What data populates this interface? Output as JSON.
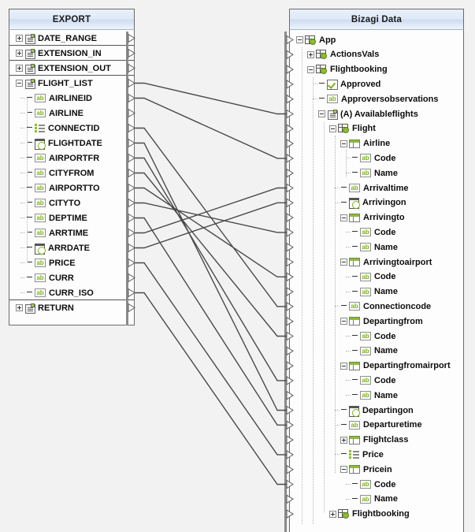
{
  "window": {
    "background": "#f2f2f2"
  },
  "left_panel": {
    "title": "EXPORT",
    "rows": [
      {
        "label": "DATE_RANGE",
        "indent": 0,
        "icon": "node-icon",
        "expander": "plus",
        "port": true,
        "separator_after": true
      },
      {
        "label": "EXTENSION_IN",
        "indent": 0,
        "icon": "node-icon",
        "expander": "plus",
        "port": true,
        "separator_after": true
      },
      {
        "label": "EXTENSION_OUT",
        "indent": 0,
        "icon": "node-icon",
        "expander": "plus",
        "port": true,
        "separator_after": true
      },
      {
        "label": "FLIGHT_LIST",
        "indent": 0,
        "icon": "node-icon",
        "expander": "minus",
        "port": true
      },
      {
        "label": "AIRLINEID",
        "indent": 1,
        "icon": "ab-icon",
        "expander": "none",
        "port": true
      },
      {
        "label": "AIRLINE",
        "indent": 1,
        "icon": "ab-icon",
        "expander": "none",
        "port": true
      },
      {
        "label": "CONNECTID",
        "indent": 1,
        "icon": "list-icon",
        "expander": "none",
        "port": true
      },
      {
        "label": "FLIGHTDATE",
        "indent": 1,
        "icon": "date-icon",
        "expander": "none",
        "port": true
      },
      {
        "label": "AIRPORTFR",
        "indent": 1,
        "icon": "ab-icon",
        "expander": "none",
        "port": true
      },
      {
        "label": "CITYFROM",
        "indent": 1,
        "icon": "ab-icon",
        "expander": "none",
        "port": true
      },
      {
        "label": "AIRPORTTO",
        "indent": 1,
        "icon": "ab-icon",
        "expander": "none",
        "port": true
      },
      {
        "label": "CITYTO",
        "indent": 1,
        "icon": "ab-icon",
        "expander": "none",
        "port": true
      },
      {
        "label": "DEPTIME",
        "indent": 1,
        "icon": "ab-icon",
        "expander": "none",
        "port": true
      },
      {
        "label": "ARRTIME",
        "indent": 1,
        "icon": "ab-icon",
        "expander": "none",
        "port": true
      },
      {
        "label": "ARRDATE",
        "indent": 1,
        "icon": "date-icon",
        "expander": "none",
        "port": true
      },
      {
        "label": "PRICE",
        "indent": 1,
        "icon": "ab-icon",
        "expander": "none",
        "port": true
      },
      {
        "label": "CURR",
        "indent": 1,
        "icon": "ab-icon",
        "expander": "none",
        "port": true
      },
      {
        "label": "CURR_ISO",
        "indent": 1,
        "icon": "ab-icon",
        "expander": "none",
        "port": true,
        "separator_after": true
      },
      {
        "label": "RETURN",
        "indent": 0,
        "icon": "node-icon",
        "expander": "plus",
        "port": true
      }
    ]
  },
  "right_panel": {
    "title": "Bizagi Data",
    "rows": [
      {
        "label": "App",
        "indent": 0,
        "icon": "entity-icon",
        "expander": "minus",
        "port": true
      },
      {
        "label": "ActionsVals",
        "indent": 1,
        "icon": "entity-icon",
        "expander": "plus",
        "port": true
      },
      {
        "label": "Flightbooking",
        "indent": 1,
        "icon": "entity-icon",
        "expander": "minus",
        "port": true
      },
      {
        "label": "Approved",
        "indent": 2,
        "icon": "bool-icon",
        "expander": "none",
        "port": true
      },
      {
        "label": "Approversobservations",
        "indent": 2,
        "icon": "ab-icon",
        "expander": "none",
        "port": true
      },
      {
        "label": "(A) Availableflights",
        "indent": 2,
        "icon": "node-icon",
        "expander": "minus",
        "port": true
      },
      {
        "label": "Flight",
        "indent": 3,
        "icon": "entity-icon",
        "expander": "minus",
        "port": true
      },
      {
        "label": "Airline",
        "indent": 4,
        "icon": "table-icon",
        "expander": "minus",
        "port": true
      },
      {
        "label": "Code",
        "indent": 5,
        "icon": "ab-icon",
        "expander": "none",
        "port": true
      },
      {
        "label": "Name",
        "indent": 5,
        "icon": "ab-icon",
        "expander": "none",
        "port": true
      },
      {
        "label": "Arrivaltime",
        "indent": 4,
        "icon": "ab-icon",
        "expander": "none",
        "port": true
      },
      {
        "label": "Arrivingon",
        "indent": 4,
        "icon": "date-icon",
        "expander": "none",
        "port": true
      },
      {
        "label": "Arrivingto",
        "indent": 4,
        "icon": "table-icon",
        "expander": "minus",
        "port": true
      },
      {
        "label": "Code",
        "indent": 5,
        "icon": "ab-icon",
        "expander": "none",
        "port": true
      },
      {
        "label": "Name",
        "indent": 5,
        "icon": "ab-icon",
        "expander": "none",
        "port": true
      },
      {
        "label": "Arrivingtoairport",
        "indent": 4,
        "icon": "table-icon",
        "expander": "minus",
        "port": true
      },
      {
        "label": "Code",
        "indent": 5,
        "icon": "ab-icon",
        "expander": "none",
        "port": true
      },
      {
        "label": "Name",
        "indent": 5,
        "icon": "ab-icon",
        "expander": "none",
        "port": true
      },
      {
        "label": "Connectioncode",
        "indent": 4,
        "icon": "ab-icon",
        "expander": "none",
        "port": true
      },
      {
        "label": "Departingfrom",
        "indent": 4,
        "icon": "table-icon",
        "expander": "minus",
        "port": true
      },
      {
        "label": "Code",
        "indent": 5,
        "icon": "ab-icon",
        "expander": "none",
        "port": true
      },
      {
        "label": "Name",
        "indent": 5,
        "icon": "ab-icon",
        "expander": "none",
        "port": true
      },
      {
        "label": "Departingfromairport",
        "indent": 4,
        "icon": "table-icon",
        "expander": "minus",
        "port": true
      },
      {
        "label": "Code",
        "indent": 5,
        "icon": "ab-icon",
        "expander": "none",
        "port": true
      },
      {
        "label": "Name",
        "indent": 5,
        "icon": "ab-icon",
        "expander": "none",
        "port": true
      },
      {
        "label": "Departingon",
        "indent": 4,
        "icon": "date-icon",
        "expander": "none",
        "port": true
      },
      {
        "label": "Departuretime",
        "indent": 4,
        "icon": "ab-icon",
        "expander": "none",
        "port": true
      },
      {
        "label": "Flightclass",
        "indent": 4,
        "icon": "table-icon",
        "expander": "plus",
        "port": true
      },
      {
        "label": "Price",
        "indent": 4,
        "icon": "list-icon",
        "expander": "none",
        "port": true
      },
      {
        "label": "Pricein",
        "indent": 4,
        "icon": "table-icon",
        "expander": "minus",
        "port": true
      },
      {
        "label": "Code",
        "indent": 5,
        "icon": "ab-icon",
        "expander": "none",
        "port": true
      },
      {
        "label": "Name",
        "indent": 5,
        "icon": "ab-icon",
        "expander": "none",
        "port": true
      },
      {
        "label": "Flightbooking",
        "indent": 3,
        "icon": "entity-icon",
        "expander": "plus",
        "port": true
      }
    ]
  },
  "mappings": [
    {
      "from": "FLIGHT_LIST",
      "to": "(A) Availableflights",
      "from_row": 3,
      "to_row": 5
    },
    {
      "from": "AIRLINEID",
      "to": "Airline / Code",
      "from_row": 4,
      "to_row": 8
    },
    {
      "from": "CONNECTID",
      "to": "Connectioncode",
      "from_row": 6,
      "to_row": 18
    },
    {
      "from": "FLIGHTDATE",
      "to": "Departingon",
      "from_row": 7,
      "to_row": 25
    },
    {
      "from": "AIRPORTFR",
      "to": "Departingfromairport / Code",
      "from_row": 8,
      "to_row": 23
    },
    {
      "from": "CITYFROM",
      "to": "Departingfrom / Code",
      "from_row": 9,
      "to_row": 20
    },
    {
      "from": "AIRPORTTO",
      "to": "Arrivingtoairport / Code",
      "from_row": 10,
      "to_row": 16
    },
    {
      "from": "CITYTO",
      "to": "Arrivingto / Code",
      "from_row": 11,
      "to_row": 13
    },
    {
      "from": "DEPTIME",
      "to": "Departuretime",
      "from_row": 12,
      "to_row": 26
    },
    {
      "from": "ARRTIME",
      "to": "Arrivaltime",
      "from_row": 13,
      "to_row": 10
    },
    {
      "from": "ARRDATE",
      "to": "Arrivingon",
      "from_row": 14,
      "to_row": 11
    },
    {
      "from": "PRICE",
      "to": "Price",
      "from_row": 15,
      "to_row": 28
    },
    {
      "from": "CURR_ISO",
      "to": "Pricein / Code",
      "from_row": 17,
      "to_row": 30
    }
  ],
  "colors": {
    "accent_green": "#8cbf2a",
    "header_blue": "#dfe9f7",
    "panel_border": "#6b6b6b",
    "link_line": "#4a4a4a",
    "canvas": "#f2f2f2"
  }
}
